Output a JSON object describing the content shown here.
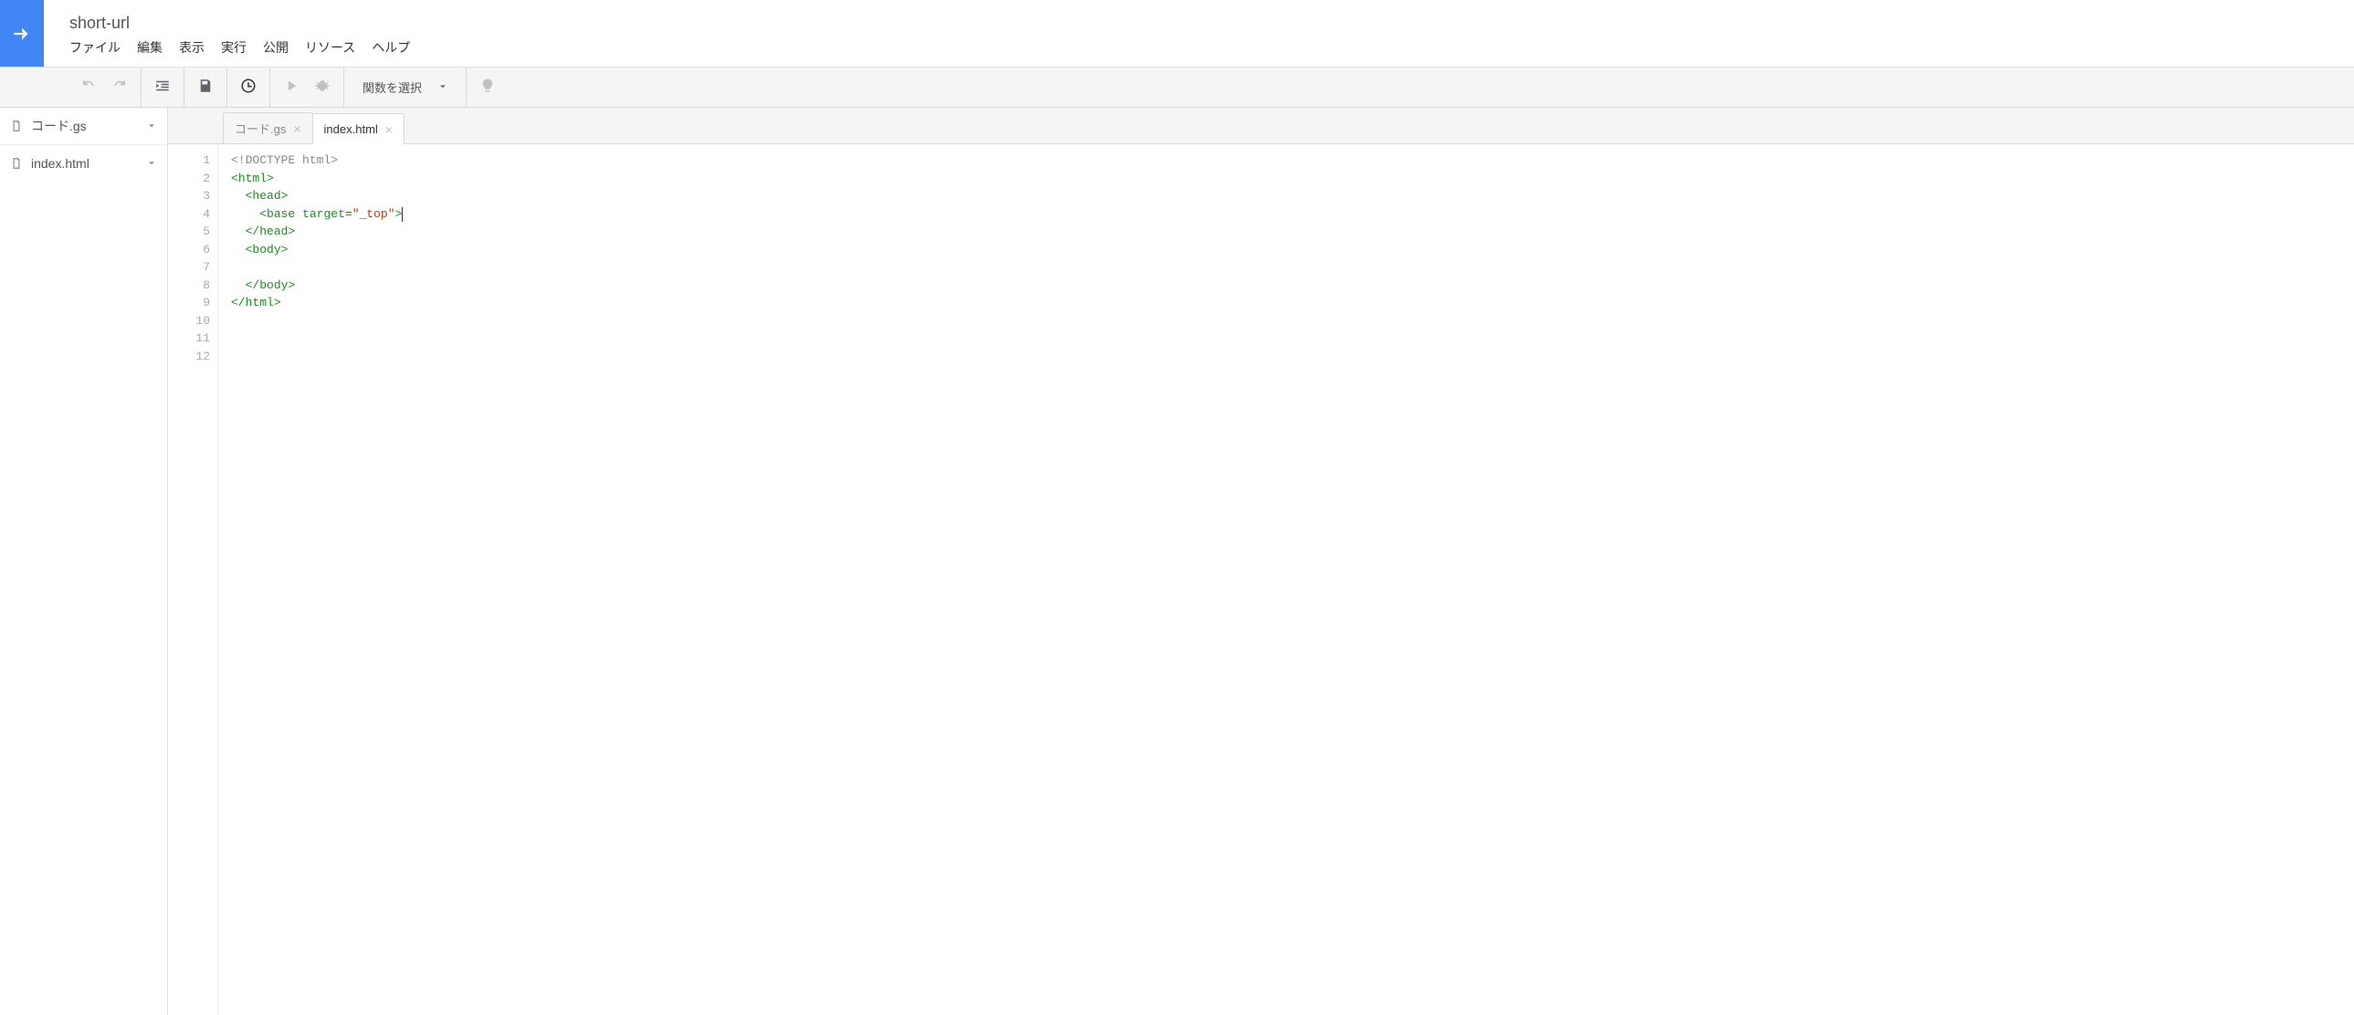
{
  "header": {
    "project_title": "short-url",
    "menu": {
      "file": "ファイル",
      "edit": "編集",
      "view": "表示",
      "run": "実行",
      "publish": "公開",
      "resources": "リソース",
      "help": "ヘルプ"
    }
  },
  "toolbar": {
    "function_select": "関数を選択"
  },
  "sidebar": {
    "files": [
      {
        "name": "コード.gs",
        "active": false
      },
      {
        "name": "index.html",
        "active": true
      }
    ]
  },
  "tabs": [
    {
      "label": "コード.gs",
      "active": false
    },
    {
      "label": "index.html",
      "active": true
    }
  ],
  "editor": {
    "line_count": 12,
    "cursor": {
      "line": 4,
      "visual_col": 24
    },
    "lines": [
      {
        "indent": 0,
        "tokens": [
          {
            "cls": "tok-doctype",
            "t": "<!DOCTYPE html>"
          }
        ]
      },
      {
        "indent": 0,
        "tokens": [
          {
            "cls": "tok-punc",
            "t": "<"
          },
          {
            "cls": "tok-tag",
            "t": "html"
          },
          {
            "cls": "tok-punc",
            "t": ">"
          }
        ]
      },
      {
        "indent": 1,
        "tokens": [
          {
            "cls": "tok-punc",
            "t": "<"
          },
          {
            "cls": "tok-tag",
            "t": "head"
          },
          {
            "cls": "tok-punc",
            "t": ">"
          }
        ]
      },
      {
        "indent": 2,
        "tokens": [
          {
            "cls": "tok-punc",
            "t": "<"
          },
          {
            "cls": "tok-tag",
            "t": "base"
          },
          {
            "cls": "",
            "t": " "
          },
          {
            "cls": "tok-attr",
            "t": "target"
          },
          {
            "cls": "tok-punc",
            "t": "="
          },
          {
            "cls": "tok-str",
            "t": "\"_top\""
          },
          {
            "cls": "tok-punc",
            "t": ">"
          }
        ]
      },
      {
        "indent": 1,
        "tokens": [
          {
            "cls": "tok-punc",
            "t": "</"
          },
          {
            "cls": "tok-tag",
            "t": "head"
          },
          {
            "cls": "tok-punc",
            "t": ">"
          }
        ]
      },
      {
        "indent": 1,
        "tokens": [
          {
            "cls": "tok-punc",
            "t": "<"
          },
          {
            "cls": "tok-tag",
            "t": "body"
          },
          {
            "cls": "tok-punc",
            "t": ">"
          }
        ]
      },
      {
        "indent": 1,
        "tokens": []
      },
      {
        "indent": 1,
        "tokens": [
          {
            "cls": "tok-punc",
            "t": "</"
          },
          {
            "cls": "tok-tag",
            "t": "body"
          },
          {
            "cls": "tok-punc",
            "t": ">"
          }
        ]
      },
      {
        "indent": 0,
        "tokens": [
          {
            "cls": "tok-punc",
            "t": "</"
          },
          {
            "cls": "tok-tag",
            "t": "html"
          },
          {
            "cls": "tok-punc",
            "t": ">"
          }
        ]
      },
      {
        "indent": 0,
        "tokens": []
      },
      {
        "indent": 0,
        "tokens": []
      },
      {
        "indent": 0,
        "tokens": []
      }
    ]
  }
}
